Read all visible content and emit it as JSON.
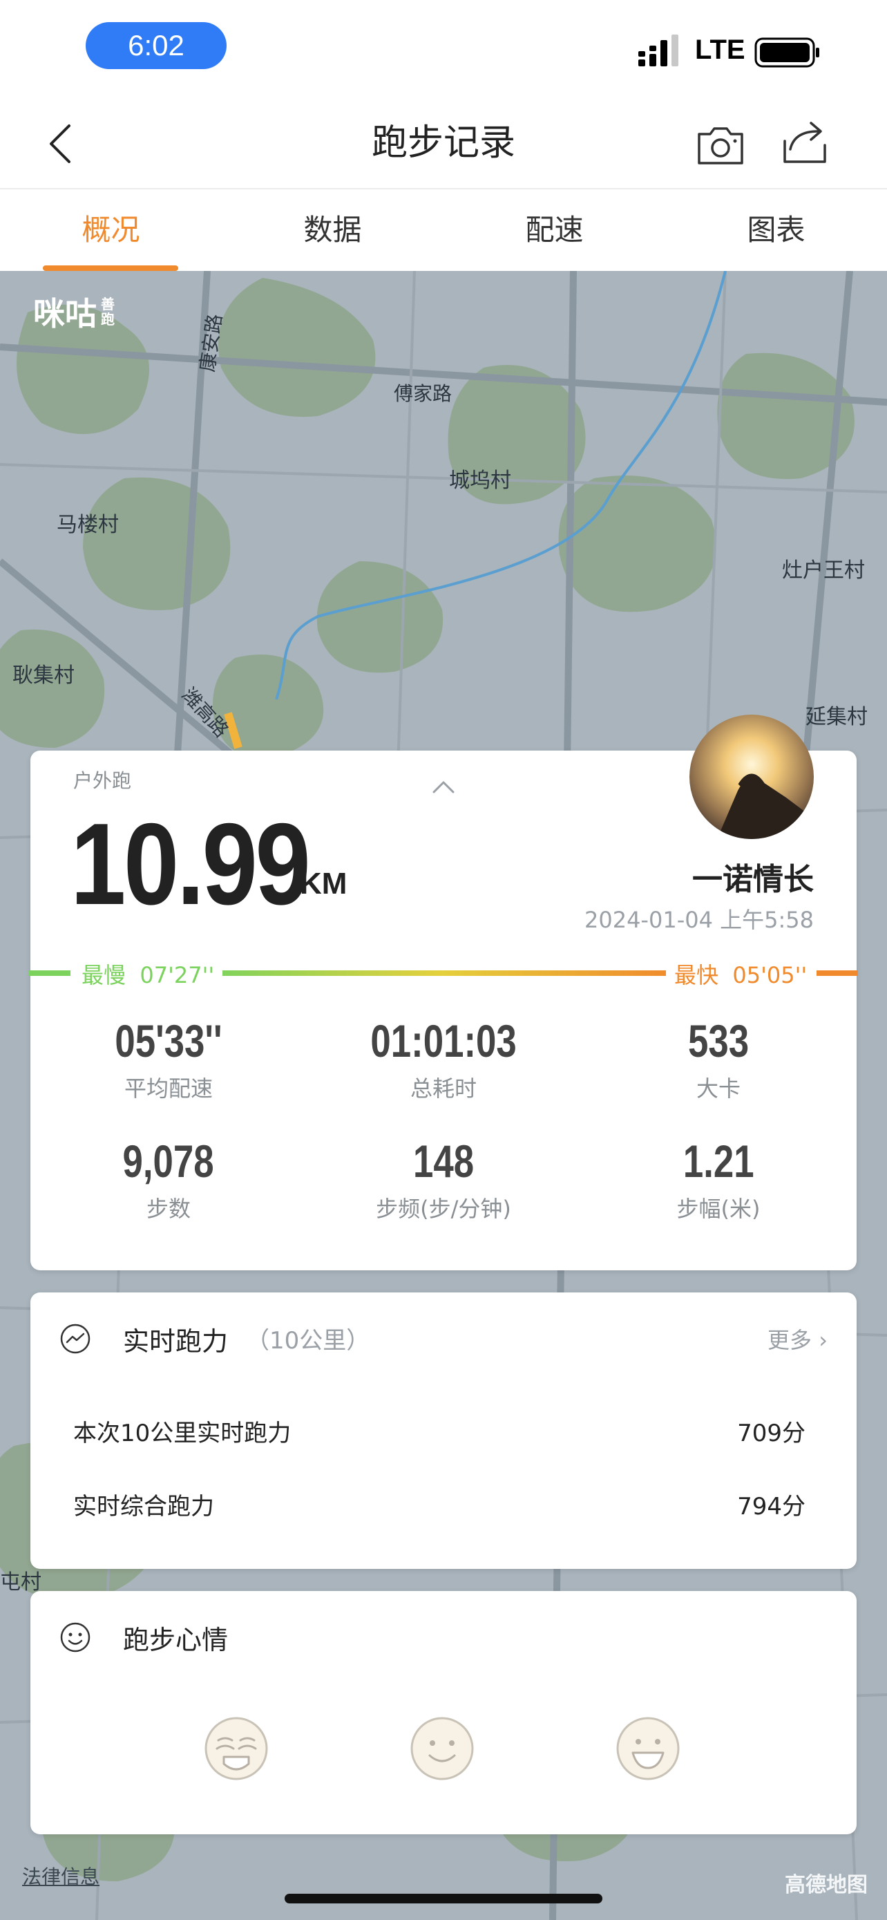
{
  "status_bar": {
    "time": "6:02",
    "network": "LTE"
  },
  "nav": {
    "title": "跑步记录"
  },
  "tabs": [
    {
      "label": "概况",
      "active": true
    },
    {
      "label": "数据",
      "active": false
    },
    {
      "label": "配速",
      "active": false
    },
    {
      "label": "图表",
      "active": false
    }
  ],
  "map": {
    "logo_main": "咪咕",
    "logo_sub": "善跑",
    "labels": [
      "康安路",
      "傅家路",
      "城坞村",
      "马楼村",
      "灶户王村",
      "耿集村",
      "潍高路",
      "延集村",
      "屯村"
    ],
    "legal": "法律信息",
    "brand": "高德地图"
  },
  "run": {
    "type": "户外跑",
    "distance": "10.99",
    "unit": "KM",
    "username": "一诺情长",
    "datetime": "2024-01-04 上午5:58",
    "slowest_label": "最慢",
    "slowest": "07'27''",
    "fastest_label": "最快",
    "fastest": "05'05''",
    "stats": [
      {
        "value": "05'33''",
        "label": "平均配速"
      },
      {
        "value": "01:01:03",
        "label": "总耗时"
      },
      {
        "value": "533",
        "label": "大卡"
      },
      {
        "value": "9,078",
        "label": "步数"
      },
      {
        "value": "148",
        "label": "步频(步/分钟)"
      },
      {
        "value": "1.21",
        "label": "步幅(米)"
      }
    ]
  },
  "power": {
    "title": "实时跑力",
    "subtitle": "（10公里）",
    "more": "更多",
    "rows": [
      {
        "label": "本次10公里实时跑力",
        "value": "709分"
      },
      {
        "label": "实时综合跑力",
        "value": "794分"
      }
    ]
  },
  "mood": {
    "title": "跑步心情"
  },
  "colors": {
    "accent": "#f08a2c",
    "slow": "#7bd35e",
    "pill": "#2f7cf6"
  }
}
